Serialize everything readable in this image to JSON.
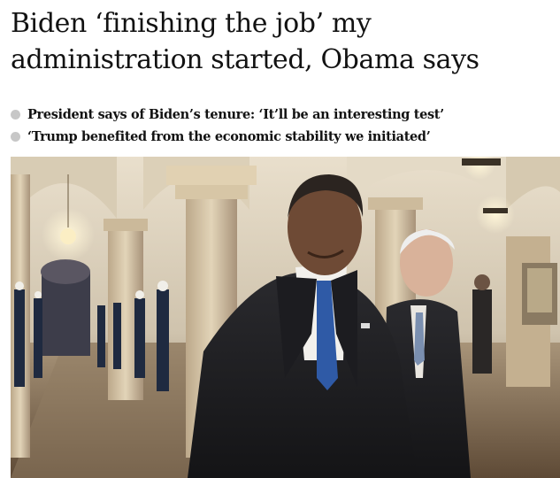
{
  "article": {
    "headline": "Biden ‘finishing the job’ my administration started, Obama says",
    "standfirst": [
      "President says of Biden’s tenure: ‘It’ll be an interesting test’",
      "‘Trump benefited from the economic stability we initiated’"
    ]
  },
  "colors": {
    "text": "#121212",
    "bullet": "#c7c7c7"
  },
  "icons": [
    "bullet-dot-icon",
    "bullet-dot-icon"
  ]
}
